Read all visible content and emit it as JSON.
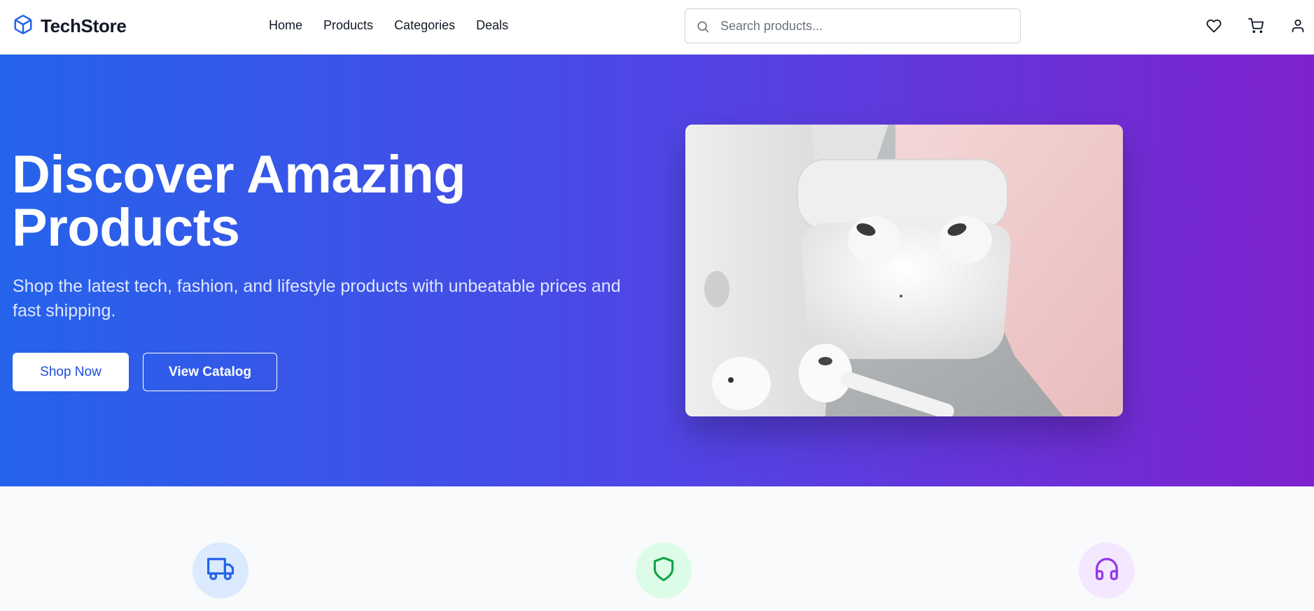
{
  "header": {
    "logo_text": "TechStore",
    "logo_icon": "box-icon",
    "nav": [
      {
        "label": "Home"
      },
      {
        "label": "Products"
      },
      {
        "label": "Categories"
      },
      {
        "label": "Deals"
      }
    ],
    "search": {
      "placeholder": "Search products...",
      "value": "",
      "icon": "search-icon"
    },
    "icons": [
      "heart-icon",
      "cart-icon",
      "user-icon"
    ]
  },
  "hero": {
    "title": "Discover Amazing Products",
    "subtitle": "Shop the latest tech, fashion, and lifestyle products with unbeatable prices and fast shipping.",
    "primary_button": "Shop Now",
    "secondary_button": "View Catalog",
    "gradient": [
      "#2563eb",
      "#4f46e5",
      "#7e22ce"
    ]
  },
  "features": [
    {
      "icon": "truck-icon",
      "color": "#2563eb",
      "bg": "#dbeafe"
    },
    {
      "icon": "shield-icon",
      "color": "#16a34a",
      "bg": "#dcfce7"
    },
    {
      "icon": "headphones-icon",
      "color": "#9333ea",
      "bg": "#f3e8ff"
    }
  ]
}
